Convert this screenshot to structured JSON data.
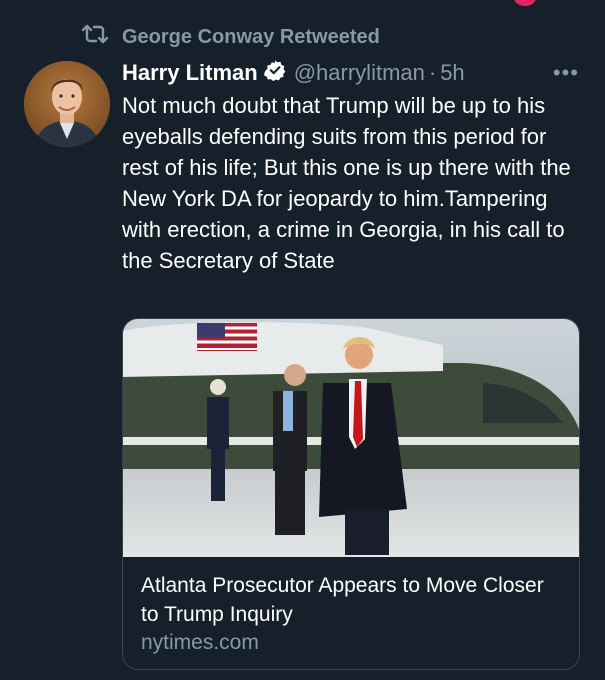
{
  "retweet": {
    "icon": "retweet-icon",
    "label": "George Conway Retweeted"
  },
  "tweet": {
    "author_name": "Harry Litman",
    "verified_icon": "verified-badge-icon",
    "handle": "@harrylitman",
    "separator": "·",
    "time": "5h",
    "more_icon": "more-options-icon",
    "more_label": "•••",
    "text": "Not much doubt that Trump will be up to his eyeballs defending suits from this period for rest of his life; But this one is up there with the New York DA for jeopardy to him.Tampering with erection, a crime in Georgia, in his call to the Secretary of State"
  },
  "card": {
    "title": "Atlanta Prosecutor Appears to Move Closer to Trump Inquiry",
    "domain": "nytimes.com"
  },
  "colors": {
    "background": "#15202b",
    "secondary_text": "#8899a6",
    "border": "#38444d",
    "verified": "#ffffff"
  }
}
